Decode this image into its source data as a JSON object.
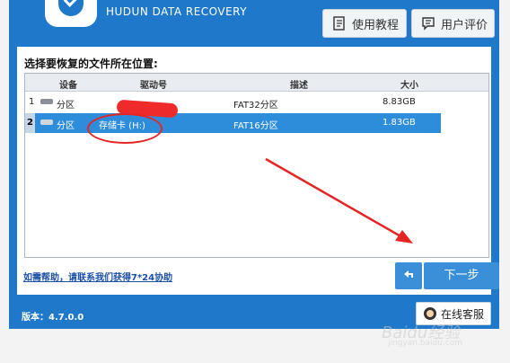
{
  "brand": {
    "name": "HUDUN DATA RECOVERY"
  },
  "top_buttons": [
    {
      "label": "使用教程",
      "icon": "document-icon"
    },
    {
      "label": "用户评价",
      "icon": "comment-icon"
    }
  ],
  "main": {
    "prompt": "选择要恢复的文件所在位置:",
    "table": {
      "columns": [
        "设备",
        "驱动号",
        "描述",
        "大小"
      ],
      "rows": [
        {
          "index": "1",
          "device": "分区",
          "drive": "",
          "desc": "FAT32分区",
          "size": "8.83GB",
          "selected": false
        },
        {
          "index": "2",
          "device": "分区",
          "drive": "存储卡 (H:)",
          "desc": "FAT16分区",
          "size": "1.83GB",
          "selected": true
        }
      ]
    },
    "help_link": "如需帮助，请联系我们获得7*24协助",
    "next_label": "下一步"
  },
  "footer": {
    "version": "版本：4.7.0.0",
    "service_label": "在线客服"
  },
  "watermark": {
    "text": "Baidu经验",
    "sub": "jingyan.baidu.com"
  },
  "colors": {
    "frame": "#1f78c9",
    "selected_row": "#2e8ddb",
    "button": "#3a8fd8",
    "annotation": "#e52424"
  }
}
